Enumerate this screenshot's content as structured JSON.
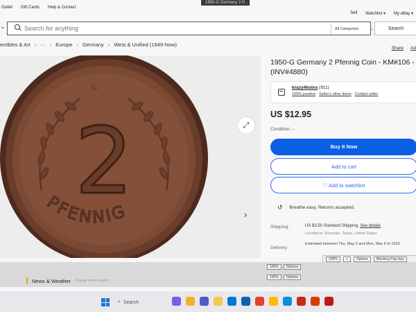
{
  "window": {
    "tab_title": "1950-G Germany 2 P..."
  },
  "top_nav": {
    "links": [
      "Outlet",
      "Gift Cards",
      "Help & Contact"
    ],
    "right_links": [
      "Sell",
      "Watchlist ▾",
      "My eBay ▾"
    ]
  },
  "search": {
    "placeholder": "Search for anything",
    "category": "All Categories",
    "button_label": "Search"
  },
  "breadcrumb": {
    "items": [
      "ectibles & Art",
      "···",
      "Europe",
      "Germany",
      "West & Unified (1949-Now)"
    ],
    "separator": "›"
  },
  "share": {
    "share_label": "Share",
    "add_label": "Ad"
  },
  "listing": {
    "title": "1950-G Germany 2 Pfennig Coin - KM#106 - (INV#4880)",
    "seller": {
      "name": "krazy4koins",
      "feedback_count": "(911)",
      "positive": "100% positive",
      "other_items": "Seller's other items",
      "contact": "Contact seller"
    },
    "price": "US $12.95",
    "condition": "Condition: --",
    "buy_now_label": "Buy It Now",
    "add_to_cart_label": "Add to cart",
    "watchlist_label": "♡ Add to watchlist",
    "returns": "Breathe easy. Returns accepted.",
    "shipping_label": "Shipping:",
    "shipping_text": "US $3.50 Standard Shipping.",
    "shipping_link": "See details",
    "shipping_location": "Located in: Roanoke, Texas, United States",
    "delivery_label": "Delivery:",
    "delivery_text": "Estimated between Thu, May 2 and Mon, May 6 to 1023"
  },
  "coin": {
    "numeral": "2",
    "legend": "PFENNIG",
    "colors": {
      "face": "#7a4a34",
      "rim": "#5e3524",
      "relief": "#8d5a40",
      "background": "#ededed"
    }
  },
  "popup_bar": {
    "zoom": "100%",
    "plus": "+",
    "options": "Options",
    "blocking": "Blocking Pop-Ups"
  },
  "mini_bars": [
    {
      "zoom": "100%",
      "options": "Options"
    },
    {
      "zoom": "100%",
      "options": "Options"
    }
  ],
  "taskbar": {
    "weather": "News & Weather",
    "weather_sub": "Change items location",
    "search_placeholder": "Search",
    "app_icon_names": [
      "photos-icon",
      "file-explorer-icon",
      "teams-icon",
      "folder-icon",
      "store-icon",
      "mail-icon",
      "chrome-icon",
      "norton-icon",
      "edge-icon",
      "solitaire-icon",
      "office-icon",
      "mcafee-icon"
    ],
    "app_colors": [
      "#7d5ce6",
      "#f0b429",
      "#5059c9",
      "#f7c948",
      "#0078d4",
      "#0a64ad",
      "#e34133",
      "#ffb900",
      "#0c8fd6",
      "#c42b1c",
      "#d83b01",
      "#c01818"
    ]
  }
}
